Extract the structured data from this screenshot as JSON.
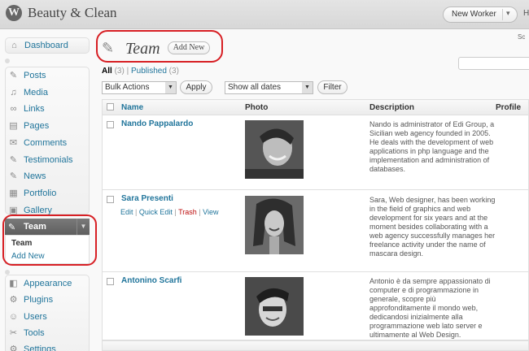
{
  "header": {
    "site_title": "Beauty & Clean",
    "favorite_action": "New Worker",
    "favorite_arrow": "▾",
    "howdy": "H"
  },
  "sidebar": {
    "items": [
      {
        "label": "Dashboard",
        "icon": "dashboard-icon"
      },
      {
        "label": "Posts",
        "icon": "pin-icon"
      },
      {
        "label": "Media",
        "icon": "media-icon"
      },
      {
        "label": "Links",
        "icon": "link-icon"
      },
      {
        "label": "Pages",
        "icon": "page-icon"
      },
      {
        "label": "Comments",
        "icon": "comment-icon"
      },
      {
        "label": "Testimonials",
        "icon": "pin-icon"
      },
      {
        "label": "News",
        "icon": "pin-icon"
      },
      {
        "label": "Portfolio",
        "icon": "portfolio-icon"
      },
      {
        "label": "Gallery",
        "icon": "gallery-icon"
      },
      {
        "label": "Team",
        "icon": "pin-icon"
      },
      {
        "label": "Appearance",
        "icon": "appearance-icon"
      },
      {
        "label": "Plugins",
        "icon": "plugin-icon"
      },
      {
        "label": "Users",
        "icon": "users-icon"
      },
      {
        "label": "Tools",
        "icon": "tools-icon"
      },
      {
        "label": "Settings",
        "icon": "settings-icon"
      }
    ],
    "team_submenu": [
      "Team",
      "Add New"
    ],
    "toggle_arrow": "▼"
  },
  "main": {
    "screen_options": "Sc",
    "title": "Team",
    "add_new": "Add New",
    "filters": {
      "all": "All",
      "all_count": "(3)",
      "separator": "|",
      "published": "Published",
      "published_count": "(3)"
    },
    "bulk_actions": "Bulk Actions",
    "apply": "Apply",
    "dates": "Show all dates",
    "filter": "Filter",
    "select_arrow": "▼",
    "columns": [
      "Name",
      "Photo",
      "Description",
      "Profile"
    ],
    "rows": [
      {
        "name": "Nando Pappalardo",
        "description": "Nando is administrator of Edi Group, a Sicilian web agency founded in 2005. He deals with the development of web applications in php language and the implementation and administration of databases."
      },
      {
        "name": "Sara Presenti",
        "actions": {
          "edit": "Edit",
          "quick_edit": "Quick Edit",
          "trash": "Trash",
          "view": "View",
          "sep": "|"
        },
        "description": "Sara, Web designer, has been working in the field of graphics and web development for six years and at the moment besides collaborating with a web agency successfully manages her freelance activity under the name of mascara design."
      },
      {
        "name": "Antonino Scarfi",
        "description": "Antonio è da sempre appassionato di computer e di programmazione in generale, scopre più approfonditamente il mondo web, dedicandosi inizialmente alla programmazione web lato server e ultimamente al Web Design."
      }
    ]
  },
  "colors": {
    "link": "#21759b",
    "highlight_ring": "#d71f24",
    "active_menu": "#6a6a6a"
  }
}
